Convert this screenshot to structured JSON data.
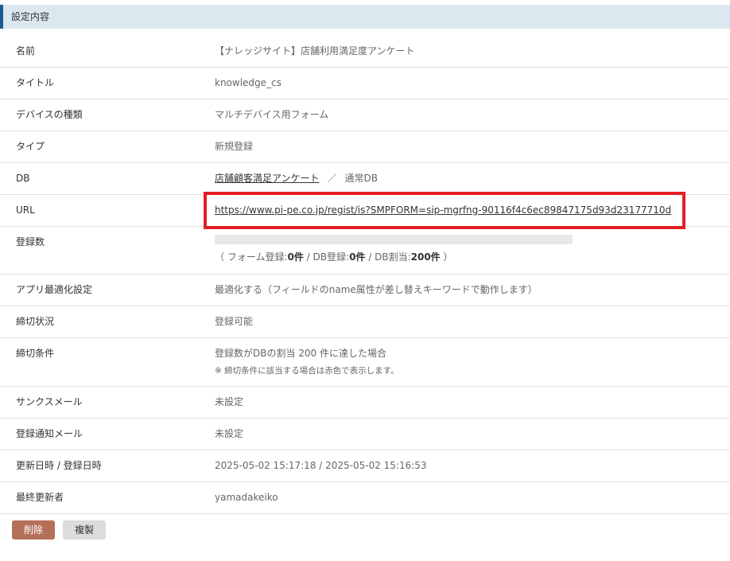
{
  "section": {
    "title": "設定内容"
  },
  "rows": {
    "name": {
      "label": "名前",
      "value": "【ナレッジサイト】店舗利用満足度アンケート"
    },
    "title": {
      "label": "タイトル",
      "value": "knowledge_cs"
    },
    "device": {
      "label": "デバイスの種類",
      "value": "マルチデバイス用フォーム"
    },
    "type": {
      "label": "タイプ",
      "value": "新規登録"
    },
    "db": {
      "label": "DB",
      "db_link": "店舗顧客満足アンケート",
      "separator": "／",
      "db_type": "通常DB"
    },
    "url": {
      "label": "URL",
      "value": "https://www.pi-pe.co.jp/regist/is?SMPFORM=sip-mgrfng-90116f4c6ec89847175d93d23177710d"
    },
    "registrations": {
      "label": "登録数",
      "progress": 0,
      "open": "（ フォーム登録:",
      "form_count": "0件",
      "db_label": " / DB登録:",
      "db_count": "0件",
      "quota_label": " / DB割当:",
      "quota_count": "200件",
      "close": " ）"
    },
    "app_opt": {
      "label": "アプリ最適化設定",
      "value": "最適化する（フィールドのname属性が差し替えキーワードで動作します）"
    },
    "deadline_status": {
      "label": "締切状況",
      "value": "登録可能"
    },
    "deadline_condition": {
      "label": "締切条件",
      "value": "登録数がDBの割当 200 件に達した場合",
      "note": "※ 締切条件に該当する場合は赤色で表示します。"
    },
    "thanks_mail": {
      "label": "サンクスメール",
      "value": "未設定"
    },
    "notify_mail": {
      "label": "登録通知メール",
      "value": "未設定"
    },
    "dates": {
      "label": "更新日時 / 登録日時",
      "value": "2025-05-02 15:17:18 / 2025-05-02 15:16:53"
    },
    "last_editor": {
      "label": "最終更新者",
      "value": "yamadakeiko"
    }
  },
  "buttons": {
    "delete": "削除",
    "copy": "複製"
  },
  "colors": {
    "header_bg": "#dbe8f0",
    "header_accent": "#1f5b8a",
    "highlight": "#e41e25",
    "delete_button": "#b5705a",
    "copy_button": "#dcdcdc"
  }
}
